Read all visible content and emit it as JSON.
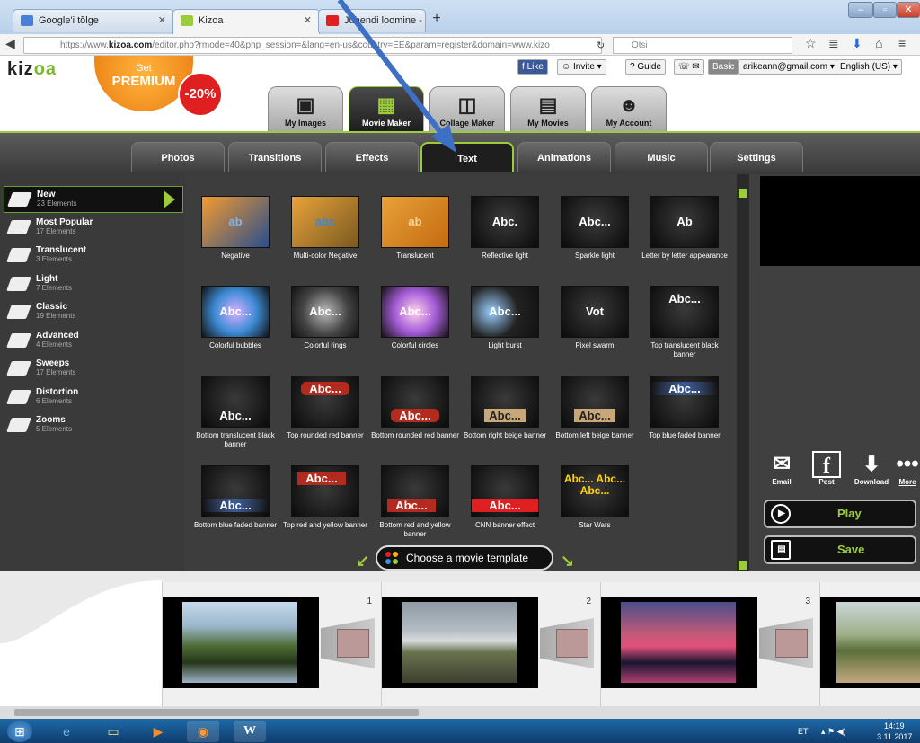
{
  "browser": {
    "tabs": [
      {
        "label": "Google'i tõlge"
      },
      {
        "label": "Kizoa"
      },
      {
        "label": "Juhendi loomine - MS Wor..."
      }
    ],
    "url_prefix": "https://www.",
    "url_domain": "kizoa.com",
    "url_rest": "/editor.php?rmode=40&php_session=&lang=en-us&country=EE&param=register&domain=www.kizo",
    "search_placeholder": "Otsi"
  },
  "header": {
    "logo_main": "kiz",
    "logo_accent": "oa",
    "premium_get": "Get",
    "premium_label": "PREMIUM",
    "discount": "-20%",
    "main_tabs": [
      {
        "label": "My Images"
      },
      {
        "label": "Movie Maker"
      },
      {
        "label": "Collage Maker"
      },
      {
        "label": "My Movies"
      },
      {
        "label": "My Account"
      }
    ],
    "like": "Like",
    "invite": "Invite",
    "guide": "Guide",
    "basic": "Basic",
    "email": "arikeann@gmail.com",
    "language": "English (US)"
  },
  "subtabs": [
    {
      "label": "Photos"
    },
    {
      "label": "Transitions"
    },
    {
      "label": "Effects"
    },
    {
      "label": "Text"
    },
    {
      "label": "Animations"
    },
    {
      "label": "Music"
    },
    {
      "label": "Settings"
    }
  ],
  "categories": [
    {
      "name": "New",
      "count": "23 Elements"
    },
    {
      "name": "Most Popular",
      "count": "17 Elements"
    },
    {
      "name": "Translucent",
      "count": "3 Elements"
    },
    {
      "name": "Light",
      "count": "7 Elements"
    },
    {
      "name": "Classic",
      "count": "19 Elements"
    },
    {
      "name": "Advanced",
      "count": "4 Elements"
    },
    {
      "name": "Sweeps",
      "count": "17 Elements"
    },
    {
      "name": "Distortion",
      "count": "6 Elements"
    },
    {
      "name": "Zooms",
      "count": "5 Elements"
    }
  ],
  "effects": [
    {
      "label": "Negative",
      "thumb": "ab"
    },
    {
      "label": "Multi-color Negative",
      "thumb": "abc"
    },
    {
      "label": "Translucent",
      "thumb": "ab"
    },
    {
      "label": "Reflective light",
      "thumb": "Abc."
    },
    {
      "label": "Sparkle light",
      "thumb": "Abc..."
    },
    {
      "label": "Letter by letter appearance",
      "thumb": "Ab"
    },
    {
      "label": "Colorful bubbles",
      "thumb": "Abc..."
    },
    {
      "label": "Colorful rings",
      "thumb": "Abc..."
    },
    {
      "label": "Colorful circles",
      "thumb": "Abc..."
    },
    {
      "label": "Light burst",
      "thumb": "Abc..."
    },
    {
      "label": "Pixel swarm",
      "thumb": "Vot"
    },
    {
      "label": "Top translucent black banner",
      "thumb": "Abc..."
    },
    {
      "label": "Bottom translucent black banner",
      "thumb": "Abc..."
    },
    {
      "label": "Top rounded red banner",
      "thumb": "Abc..."
    },
    {
      "label": "Bottom rounded red banner",
      "thumb": "Abc..."
    },
    {
      "label": "Bottom right beige banner",
      "thumb": "Abc..."
    },
    {
      "label": "Bottom left beige banner",
      "thumb": "Abc..."
    },
    {
      "label": "Top blue faded banner",
      "thumb": "Abc..."
    },
    {
      "label": "Bottom blue faded banner",
      "thumb": "Abc..."
    },
    {
      "label": "Top red and yellow banner",
      "thumb": "Abc..."
    },
    {
      "label": "Bottom red and yellow banner",
      "thumb": "Abc..."
    },
    {
      "label": "CNN banner effect",
      "thumb": "Abc..."
    },
    {
      "label": "Star Wars",
      "thumb": "Abc... Abc... Abc..."
    }
  ],
  "share": [
    {
      "label": "Email"
    },
    {
      "label": "Post"
    },
    {
      "label": "Download"
    },
    {
      "label": "More"
    }
  ],
  "play_label": "Play",
  "save_label": "Save",
  "choose_template": "Choose a movie template",
  "timeline": [
    {
      "num": "1"
    },
    {
      "num": "2"
    },
    {
      "num": "3"
    }
  ],
  "tray": {
    "lang": "ET",
    "time": "14:19",
    "date": "3.11.2017"
  },
  "colors": {
    "accent": "#9ccc3c",
    "premium": "#ea7b12",
    "discount": "#e02020"
  }
}
